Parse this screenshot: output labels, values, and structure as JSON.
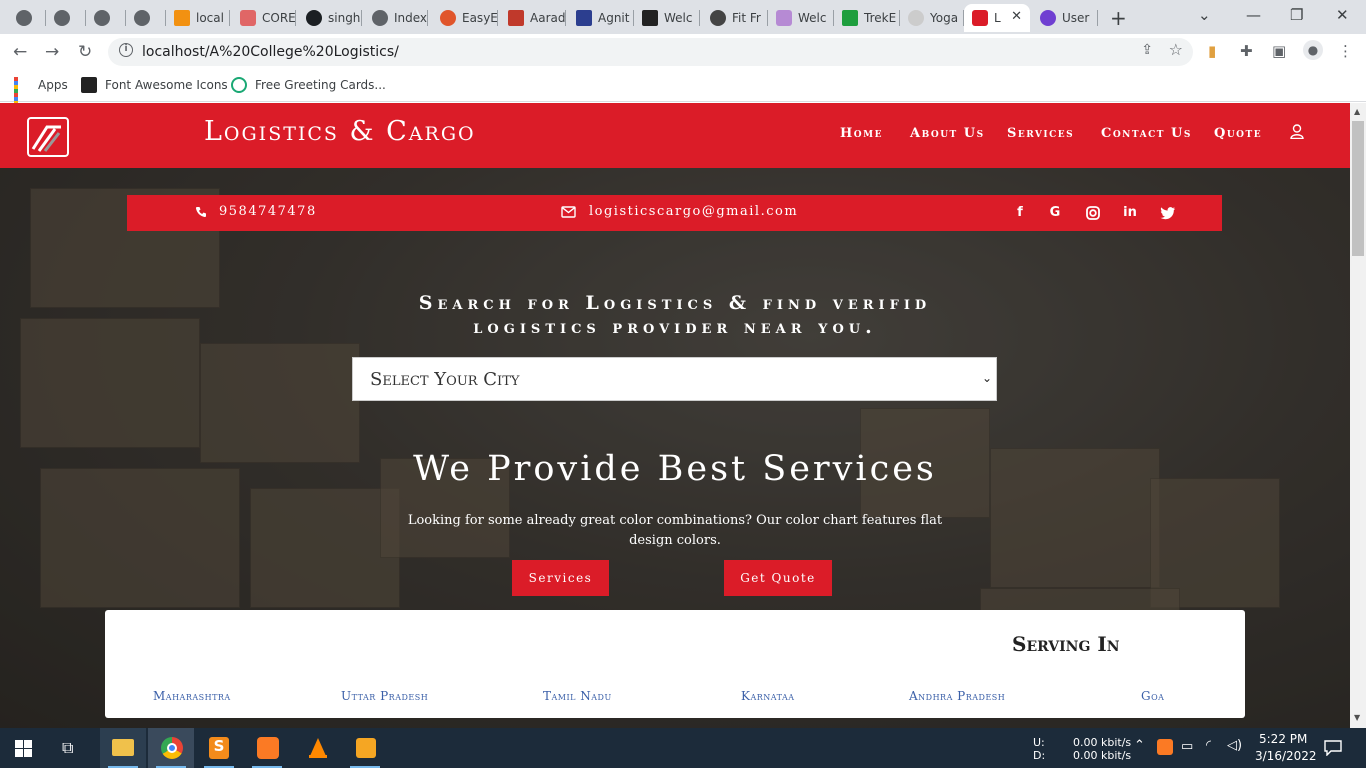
{
  "browser": {
    "tabs": [
      {
        "label": "",
        "icon": "globe-icon"
      },
      {
        "label": "",
        "icon": "globe-icon"
      },
      {
        "label": "",
        "icon": "globe-icon"
      },
      {
        "label": "",
        "icon": "globe-icon"
      },
      {
        "label": "local",
        "icon": "phpmyadmin-icon"
      },
      {
        "label": "CORE",
        "icon": "core-icon"
      },
      {
        "label": "singh",
        "icon": "github-icon"
      },
      {
        "label": "Index",
        "icon": "globe-icon"
      },
      {
        "label": "EasyE",
        "icon": "easy-icon"
      },
      {
        "label": "Aarad",
        "icon": "aarad-icon"
      },
      {
        "label": "Agnit",
        "icon": "agnit-icon"
      },
      {
        "label": "Welc",
        "icon": "arch-icon"
      },
      {
        "label": "Fit Fr",
        "icon": "shield-icon"
      },
      {
        "label": "Welc",
        "icon": "purple-icon"
      },
      {
        "label": "TrekE",
        "icon": "trek-icon"
      },
      {
        "label": "Yoga",
        "icon": "yoga-icon"
      },
      {
        "label": "L",
        "icon": "logistics-icon",
        "active": true
      },
      {
        "label": "User",
        "icon": "user-purple-icon"
      }
    ],
    "url": "localhost/A%20College%20Logistics/",
    "bookmarks": [
      {
        "label": "Apps",
        "icon": "apps-grid-icon"
      },
      {
        "label": "Font Awesome Icons",
        "icon": "flag-icon"
      },
      {
        "label": "Free Greeting Cards...",
        "icon": "greeting-icon"
      }
    ]
  },
  "site": {
    "brand": "Logistics & Cargo",
    "nav": [
      "Home",
      "About Us",
      "Services",
      "Contact Us",
      "Quote"
    ],
    "contact": {
      "phone": "9584747478",
      "email": "logisticscargo@gmail.com"
    },
    "social": [
      "facebook-icon",
      "google-icon",
      "instagram-icon",
      "linkedin-icon",
      "twitter-icon"
    ],
    "search_title_line1": "Search for Logistics & find verifid",
    "search_title_line2": "logistics provider near you.",
    "city_select": "Select Your City",
    "headline": "We Provide Best Services",
    "subtext": "Looking for some already great color combinations? Our color chart features flat design colors.",
    "buttons": {
      "services": "Services",
      "quote": "Get Quote"
    },
    "serving": {
      "title": "Serving In",
      "states": [
        "Maharashtra",
        "Uttar Pradesh",
        "Tamil Nadu",
        "Karnataa",
        "Andhra Pradesh",
        "Goa"
      ]
    }
  },
  "taskbar": {
    "net_up_label": "U:",
    "net_down_label": "D:",
    "net_up": "0.00 kbit/s",
    "net_down": "0.00 kbit/s",
    "time": "5:22 PM",
    "date": "3/16/2022"
  },
  "colors": {
    "brand_red": "#db1c28",
    "state_blue": "#3a5fa8"
  }
}
